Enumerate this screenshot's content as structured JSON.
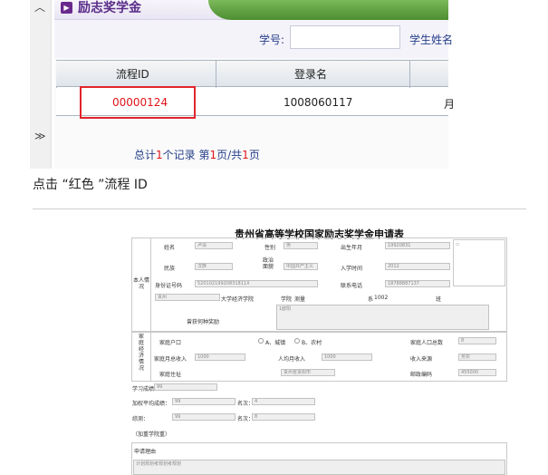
{
  "top": {
    "title": "励志奖学金",
    "search": {
      "student_id_label": "学号:",
      "student_name_label": "学生姓名"
    },
    "table": {
      "headers": [
        "流程ID",
        "登录名"
      ],
      "row": {
        "id": "00000124",
        "login": "1008060117",
        "extra": "月"
      }
    },
    "pager": {
      "prefix": "总计",
      "count": "1",
      "mid": "个记录 第",
      "page": "1",
      "sep": "页/共",
      "total": "1",
      "suffix": "页"
    }
  },
  "caption": "点击 “红色 ”流程 ID",
  "form": {
    "title": "贵州省高等学校国家励志奖学金申请表",
    "section_personal": "本人情况",
    "section_family": "家庭经济情况",
    "labels": {
      "name": "姓名",
      "gender": "性别",
      "birth": "出生年月",
      "ethnicity": "民族",
      "political": "政治面貌",
      "enroll": "入学时间",
      "idcard": "身份证号码",
      "phone": "联系电话",
      "univ": "大学",
      "college": "学院",
      "dept": "系",
      "class": "班",
      "awards": "曾获何种奖励",
      "hukou": "家庭户口",
      "urban": "A、城镇",
      "rural": "B、农村",
      "members": "家庭人口总数",
      "income": "家庭月总收入",
      "per_capita": "人均月收入",
      "source": "收入来源",
      "address": "家庭住址",
      "postcode": "邮政编码",
      "score": "学习成绩",
      "gpa": "加权平均成绩：",
      "rank": "名次：",
      "comprehensive": "综测：",
      "rank2": "名次：",
      "note": "（加重学院重）",
      "reason": "申请理由"
    },
    "values": {
      "name": "卢清",
      "gender": "男",
      "birth": "19920831",
      "ethnicity": "汉族",
      "political": "中国共产主义",
      "enroll": "2012",
      "idcard": "52010219920831811X",
      "phone": "18788887137",
      "univ": "贵州",
      "college_name": "经济学院",
      "major": "测量",
      "dept_no": "1002",
      "awards": "1欧阳",
      "members": "8",
      "income": "1000",
      "per_capita": "1000",
      "source": "务农",
      "address": "贵州省贵阳市",
      "postcode": "455000",
      "score": "99",
      "gpa": "99",
      "rank": "4",
      "comprehensive": "99",
      "rank2": "8",
      "reason": "计划规划考规划考规划"
    }
  }
}
